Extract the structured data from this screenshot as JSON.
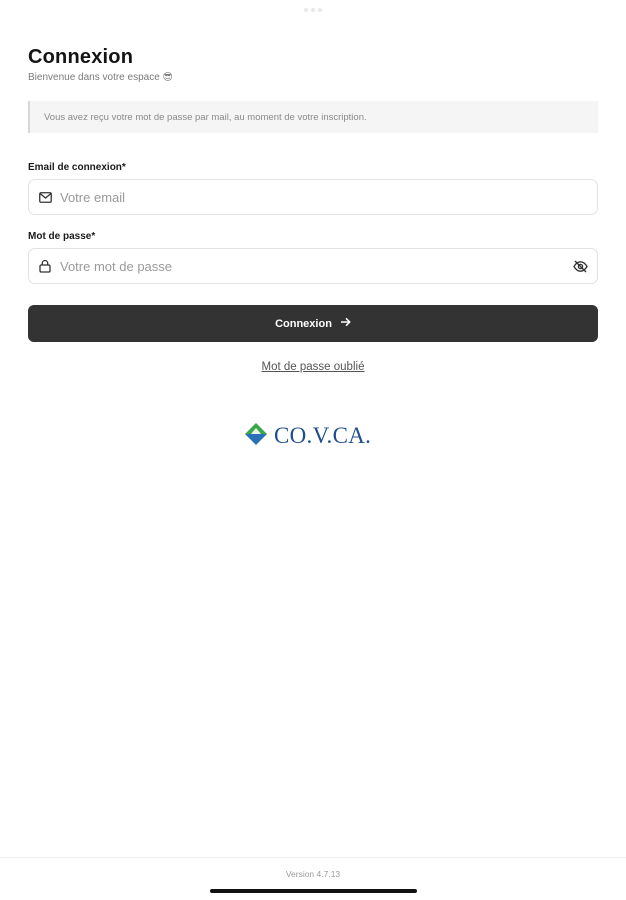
{
  "header": {
    "title": "Connexion",
    "subtitle": "Bienvenue dans votre espace 😎"
  },
  "info": {
    "message": "Vous avez reçu votre mot de passe par mail, au moment de votre inscription."
  },
  "form": {
    "email": {
      "label": "Email de connexion*",
      "placeholder": "Votre email",
      "value": "",
      "icon": "mail-icon"
    },
    "password": {
      "label": "Mot de passe*",
      "placeholder": "Votre mot de passe",
      "value": "",
      "icon": "lock-icon",
      "toggle_icon": "eye-off-icon"
    },
    "submit_label": "Connexion",
    "submit_icon": "arrow-right-icon",
    "forgot_label": "Mot de passe oublié"
  },
  "brand": {
    "logo_text": "CO.V.CA.",
    "logo_colors": {
      "green": "#3aa84a",
      "blue": "#2a6fb8",
      "text": "#1f4e8c"
    }
  },
  "footer": {
    "version": "Version 4.7.13"
  },
  "colors": {
    "button_bg": "#333333",
    "info_bg": "#f5f5f5"
  }
}
